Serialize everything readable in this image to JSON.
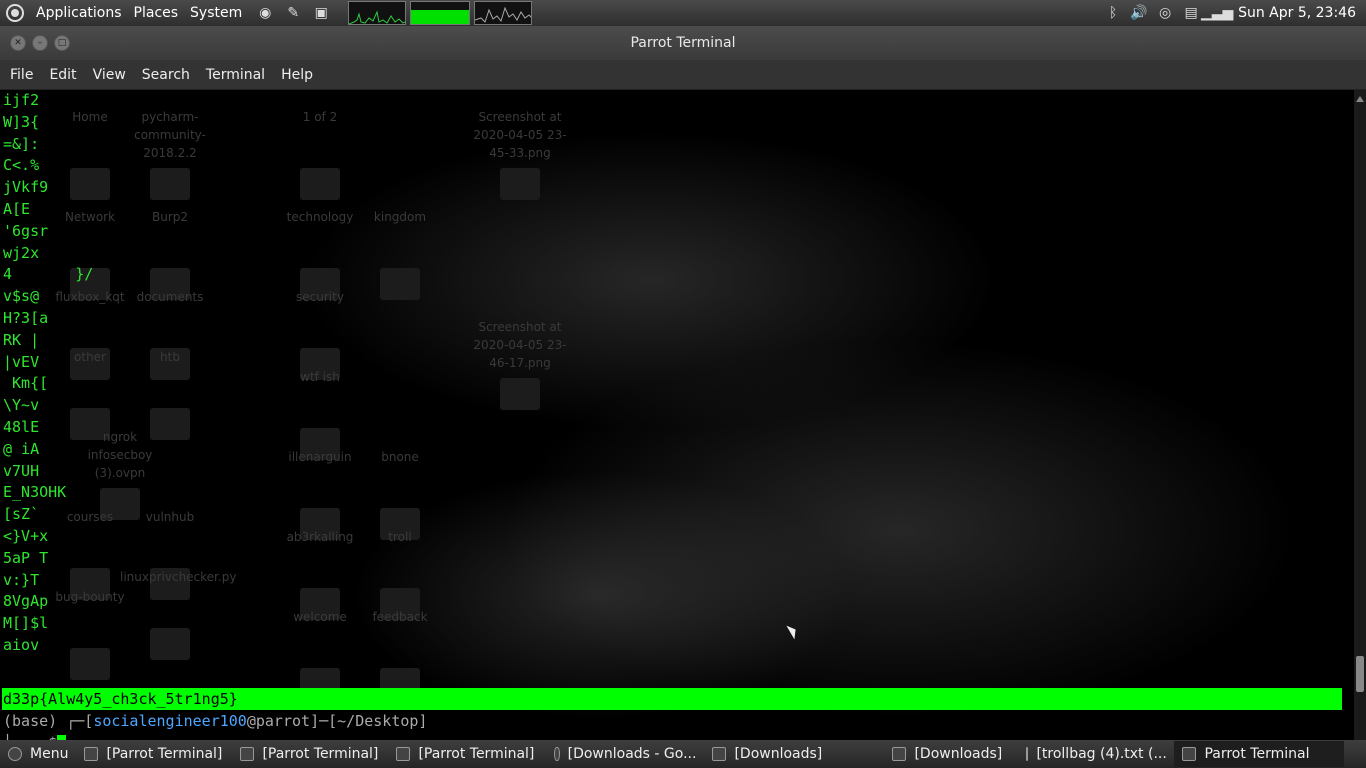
{
  "top_panel": {
    "menus": [
      "Applications",
      "Places",
      "System"
    ],
    "clock": "Sun Apr 5, 23:46"
  },
  "window": {
    "title": "Parrot Terminal",
    "menu": [
      "File",
      "Edit",
      "View",
      "Search",
      "Terminal",
      "Help"
    ]
  },
  "terminal": {
    "lines": [
      "ijf2",
      "W]3{",
      "=&]:",
      "C<.%",
      "jVkf9",
      "A[E",
      "'6gsr",
      "wj2x",
      "4       }/",
      "v$s@",
      "H?3[a",
      "RK |",
      "|vEV",
      " Km{[",
      "\\Y~v",
      "48lE",
      "@ iA",
      "v7UH",
      "E_N3OHK",
      "[sZ`",
      "<}V+x",
      "5aP T",
      "v:}T",
      "8VgAp",
      "M[]$l",
      "aiov"
    ],
    "flag": "d33p{Alw4y5_ch3ck_5tr1ng5}",
    "prompt_env": "(base) ",
    "prompt_user": "socialengineer100",
    "prompt_host": "@parrot",
    "prompt_path": "[~/Desktop]",
    "prompt_symbol": "$"
  },
  "desktop_ghost_labels": [
    "Home",
    "pycharm-community-2018.2.2",
    "1 of 2",
    "Screenshot at 2020-04-05 23-45-33.png",
    "Network",
    "Burp2",
    "technology",
    "kingdom",
    "fluxbox_kqt",
    "documents",
    "security",
    "other",
    "htb",
    "Screenshot at 2020-04-05 23-46-17.png",
    "wtf ish",
    "ngrok infosecboy (3).ovpn",
    "illenarguin",
    "bnone",
    "courses",
    "vulnhub",
    "ab3rkalling",
    "troll",
    "linuxprivchecker.py",
    "bug-bounty",
    "welcome",
    "feedback"
  ],
  "taskbar": {
    "menu": "Menu",
    "tasks": [
      "[Parrot Terminal]",
      "[Parrot Terminal]",
      "[Parrot Terminal]",
      "[Downloads - Go...",
      "[Downloads]",
      "[Downloads]",
      "[trollbag (4).txt (...",
      "Parrot Terminal"
    ]
  },
  "colors": {
    "terminal_text": "#2ee62e",
    "flag_bg": "#00ff00",
    "user": "#4da6ff"
  }
}
